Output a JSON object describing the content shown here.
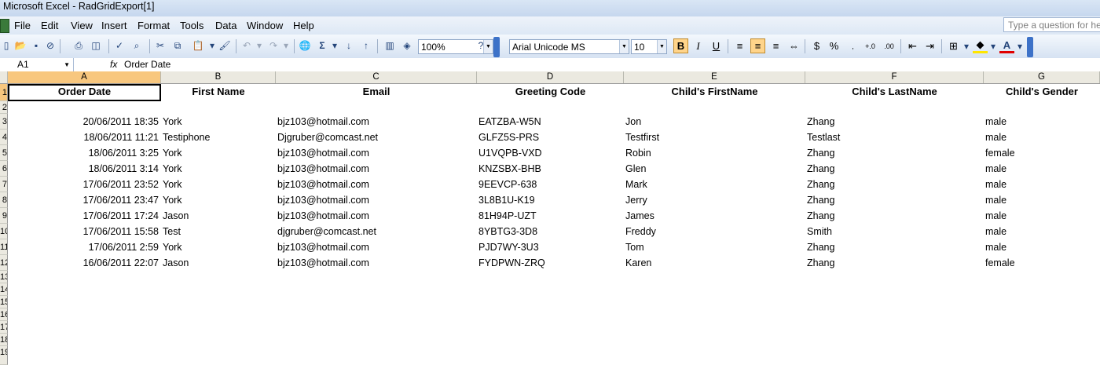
{
  "window": {
    "title": "Microsoft Excel - RadGridExport[1]"
  },
  "menu": {
    "items": [
      {
        "label": "File"
      },
      {
        "label": "Edit"
      },
      {
        "label": "View"
      },
      {
        "label": "Insert"
      },
      {
        "label": "Format"
      },
      {
        "label": "Tools"
      },
      {
        "label": "Data"
      },
      {
        "label": "Window"
      },
      {
        "label": "Help"
      }
    ],
    "question_placeholder": "Type a question for help"
  },
  "toolbar": {
    "zoom": "100%",
    "font_name": "Arial Unicode MS",
    "font_size": "10",
    "bold_label": "B",
    "italic_label": "I",
    "underline_label": "U",
    "currency_label": "$",
    "percent_label": "%"
  },
  "formula_bar": {
    "name_box": "A1",
    "fx_label": "fx",
    "content": "Order Date"
  },
  "columns": [
    "A",
    "B",
    "C",
    "D",
    "E",
    "F",
    "G"
  ],
  "row_numbers": [
    "1",
    "2",
    "3",
    "4",
    "5",
    "6",
    "7",
    "8",
    "9",
    "10",
    "11",
    "12",
    "13",
    "14",
    "15",
    "16",
    "17",
    "18",
    "19"
  ],
  "sheet": {
    "headers": [
      "Order Date",
      "First Name",
      "Email",
      "Greeting Code",
      "Child's FirstName",
      "Child's LastName",
      "Child's Gender"
    ],
    "rows": [
      [
        "20/06/2011 18:35",
        "York",
        "bjz103@hotmail.com",
        "EATZBA-W5N",
        "Jon",
        "Zhang",
        "male"
      ],
      [
        "18/06/2011 11:21",
        "Testiphone",
        "Djgruber@comcast.net",
        "GLFZ5S-PRS",
        "Testfirst",
        "Testlast",
        "male"
      ],
      [
        "18/06/2011 3:25",
        "York",
        "bjz103@hotmail.com",
        "U1VQPB-VXD",
        "Robin",
        "Zhang",
        "female"
      ],
      [
        "18/06/2011 3:14",
        "York",
        "bjz103@hotmail.com",
        "KNZSBX-BHB",
        "Glen",
        "Zhang",
        "male"
      ],
      [
        "17/06/2011 23:52",
        "York",
        "bjz103@hotmail.com",
        "9EEVCP-638",
        "Mark",
        "Zhang",
        "male"
      ],
      [
        "17/06/2011 23:47",
        "York",
        "bjz103@hotmail.com",
        "3L8B1U-K19",
        "Jerry",
        "Zhang",
        "male"
      ],
      [
        "17/06/2011 17:24",
        "Jason",
        "bjz103@hotmail.com",
        "81H94P-UZT",
        "James",
        "Zhang",
        "male"
      ],
      [
        "17/06/2011 15:58",
        "Test",
        "djgruber@comcast.net",
        "8YBTG3-3D8",
        "Freddy",
        "Smith",
        "male"
      ],
      [
        "17/06/2011 2:59",
        "York",
        "bjz103@hotmail.com",
        "PJD7WY-3U3",
        "Tom",
        "Zhang",
        "male"
      ],
      [
        "16/06/2011 22:07",
        "Jason",
        "bjz103@hotmail.com",
        "FYDPWN-ZRQ",
        "Karen",
        "Zhang",
        "female"
      ]
    ]
  }
}
